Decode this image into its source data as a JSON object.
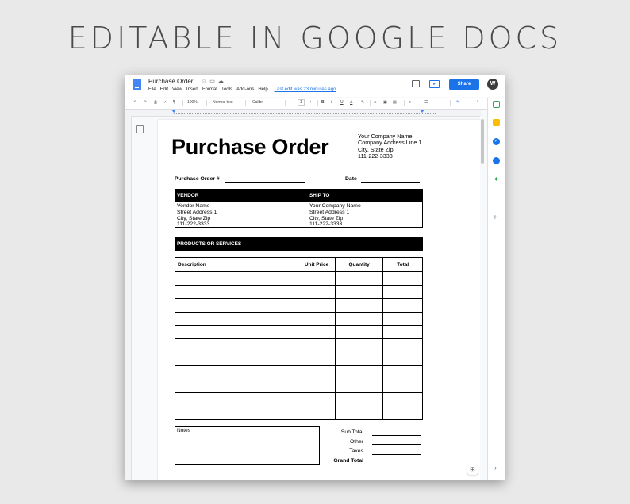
{
  "headline": "EDITABLE IN GOOGLE DOCS",
  "app": {
    "doc_title": "Purchase Order",
    "menus": [
      "File",
      "Edit",
      "View",
      "Insert",
      "Format",
      "Tools",
      "Add-ons",
      "Help"
    ],
    "last_edit": "Last edit was 23 minutes ago",
    "share_label": "Share",
    "avatar_initial": "W",
    "accent_color": "#1a73e8"
  },
  "toolbar": {
    "zoom": "100%",
    "style": "Normal text",
    "font": "Calibri",
    "font_size": "1",
    "icons": [
      "undo-icon",
      "redo-icon",
      "print-icon",
      "spellcheck-icon",
      "paint-format-icon",
      "bold-icon",
      "italic-icon",
      "underline-icon",
      "text-color-icon",
      "highlight-icon",
      "link-icon",
      "comment-icon",
      "image-icon",
      "align-icon",
      "line-spacing-icon",
      "edit-mode-icon",
      "collapse-icon"
    ]
  },
  "document": {
    "title": "Purchase Order",
    "company": {
      "name": "Your Company Name",
      "address": "Company Address Line 1",
      "city": "City, State Zip",
      "phone": "111-222-3333"
    },
    "po_label": "Purchase Order #",
    "date_label": "Date",
    "vendor_header": "VENDOR",
    "ship_header": "SHIP TO",
    "vendor": {
      "name": "Vendor Name",
      "address": "Street Address 1",
      "city": "City, State Zip",
      "phone": "111-222-3333"
    },
    "ship_to": {
      "name": "Your Company Name",
      "address": "Street Address 1",
      "city": "City, State Zip",
      "phone": "111-222-3333"
    },
    "products_header": "PRODUCTS OR SERVICES",
    "columns": [
      "Description",
      "Unit Price",
      "Quantity",
      "Total"
    ],
    "notes_label": "Notes",
    "totals": [
      "Sub Total",
      "Other",
      "Taxes",
      "Grand Total"
    ]
  }
}
